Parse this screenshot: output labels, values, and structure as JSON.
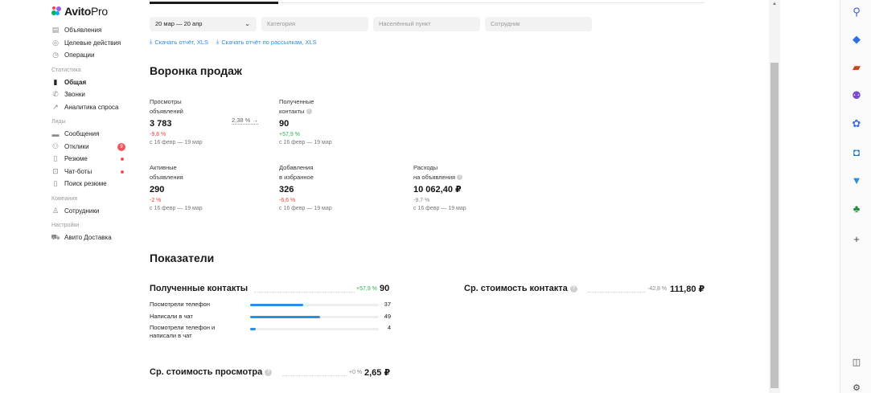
{
  "brand": {
    "name": "Avito",
    "suffix": "Pro"
  },
  "sidebar": {
    "items_top": [
      {
        "label": "Объявления",
        "icon": "listings-icon"
      },
      {
        "label": "Целевые действия",
        "icon": "target-icon"
      },
      {
        "label": "Операции",
        "icon": "operations-icon"
      }
    ],
    "groups": [
      {
        "title": "Статистика",
        "items": [
          {
            "label": "Общая",
            "icon": "bar-chart-icon",
            "active": true
          },
          {
            "label": "Звонки",
            "icon": "phone-icon"
          },
          {
            "label": "Аналитика спроса",
            "icon": "trend-icon"
          }
        ]
      },
      {
        "title": "Лиды",
        "items": [
          {
            "label": "Сообщения",
            "icon": "chat-icon"
          },
          {
            "label": "Отклики",
            "icon": "responses-icon",
            "badge": "9"
          },
          {
            "label": "Резюме",
            "icon": "resume-icon",
            "dot": true
          },
          {
            "label": "Чат-боты",
            "icon": "bot-icon",
            "dot": true
          },
          {
            "label": "Поиск резюме",
            "icon": "search-resume-icon"
          }
        ]
      },
      {
        "title": "Компания",
        "items": [
          {
            "label": "Сотрудники",
            "icon": "employees-icon"
          }
        ]
      },
      {
        "title": "Настройки",
        "items": [
          {
            "label": "Авито Доставка",
            "icon": "delivery-icon"
          }
        ]
      }
    ]
  },
  "filters": {
    "date": "20 мар — 20 апр",
    "category_placeholder": "Категория",
    "city_placeholder": "Населённый пункт",
    "employee_placeholder": "Сотрудник"
  },
  "downloads": {
    "report": "Скачать отчёт, XLS",
    "mailing": "Скачать отчёт по рассылкам, XLS"
  },
  "funnel": {
    "title": "Воронка продаж",
    "conversion": "2,38 % →",
    "metrics": [
      {
        "label1": "Просмотры",
        "label2": "объявлений",
        "value": "3 783",
        "change": "-9,8 %",
        "change_type": "neg",
        "period": "с 16 февр — 19 мар",
        "help": false
      },
      {
        "label1": "Полученные",
        "label2": "контакты",
        "value": "90",
        "change": "+57,9 %",
        "change_type": "pos",
        "period": "с 16 февр — 19 мар",
        "help": true
      },
      {
        "label1": "Активные",
        "label2": "объявления",
        "value": "290",
        "change": "-2 %",
        "change_type": "neg",
        "period": "с 16 февр — 19 мар",
        "help": false
      },
      {
        "label1": "Добавления",
        "label2": "в избранное",
        "value": "326",
        "change": "-6,6 %",
        "change_type": "neg",
        "period": "с 16 февр — 19 мар",
        "help": false
      },
      {
        "label1": "Расходы",
        "label2": "на объявления",
        "value": "10 062,40 ₽",
        "change": "-9,7 %",
        "change_type": "neu",
        "period": "с 16 февр — 19 мар",
        "help": true
      }
    ]
  },
  "indicators": {
    "title": "Показатели",
    "contacts": {
      "title": "Полученные контакты",
      "change": "+57,9 %",
      "value": "90",
      "rows": [
        {
          "label": "Посмотрели телефон",
          "value": 37
        },
        {
          "label": "Написали в чат",
          "value": 49
        },
        {
          "label": "Посмотрели телефон и написали в чат",
          "value": 4
        }
      ]
    },
    "contact_cost": {
      "title": "Ср. стоимость контакта",
      "change": "-42,8 %",
      "value": "111,80 ₽"
    },
    "view_cost": {
      "title": "Ср. стоимость просмотра",
      "change": "+0 %",
      "value": "2,65 ₽"
    }
  },
  "right_toolbar": [
    "search-icon",
    "tag-icon",
    "briefcase-icon",
    "people-icon",
    "copilot-icon",
    "outlook-icon",
    "send-icon",
    "tree-icon",
    "plus-icon",
    "sidebar-toggle-icon",
    "settings-icon"
  ]
}
